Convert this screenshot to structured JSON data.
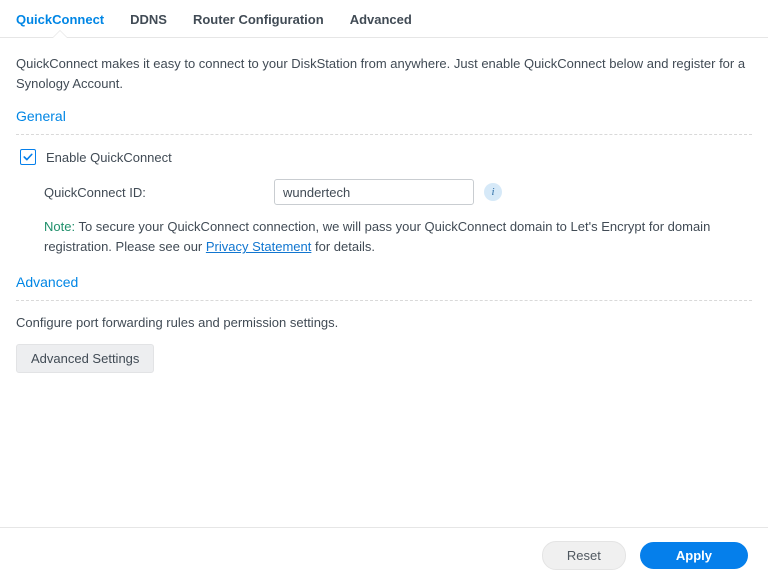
{
  "tabs": {
    "quickconnect": "QuickConnect",
    "ddns": "DDNS",
    "router": "Router Configuration",
    "advanced": "Advanced"
  },
  "intro": "QuickConnect makes it easy to connect to your DiskStation from anywhere. Just enable QuickConnect below and register for a Synology Account.",
  "sections": {
    "general_title": "General",
    "enable_label": "Enable QuickConnect",
    "qc_id_label": "QuickConnect ID:",
    "qc_id_value": "wundertech",
    "note_label": "Note:",
    "note_text_1": " To secure your QuickConnect connection, we will pass your QuickConnect domain to Let's Encrypt for domain registration. Please see our ",
    "privacy_link": "Privacy Statement",
    "note_text_2": " for details.",
    "advanced_title": "Advanced",
    "advanced_desc": "Configure port forwarding rules and permission settings.",
    "advanced_btn": "Advanced Settings"
  },
  "footer": {
    "reset": "Reset",
    "apply": "Apply"
  }
}
